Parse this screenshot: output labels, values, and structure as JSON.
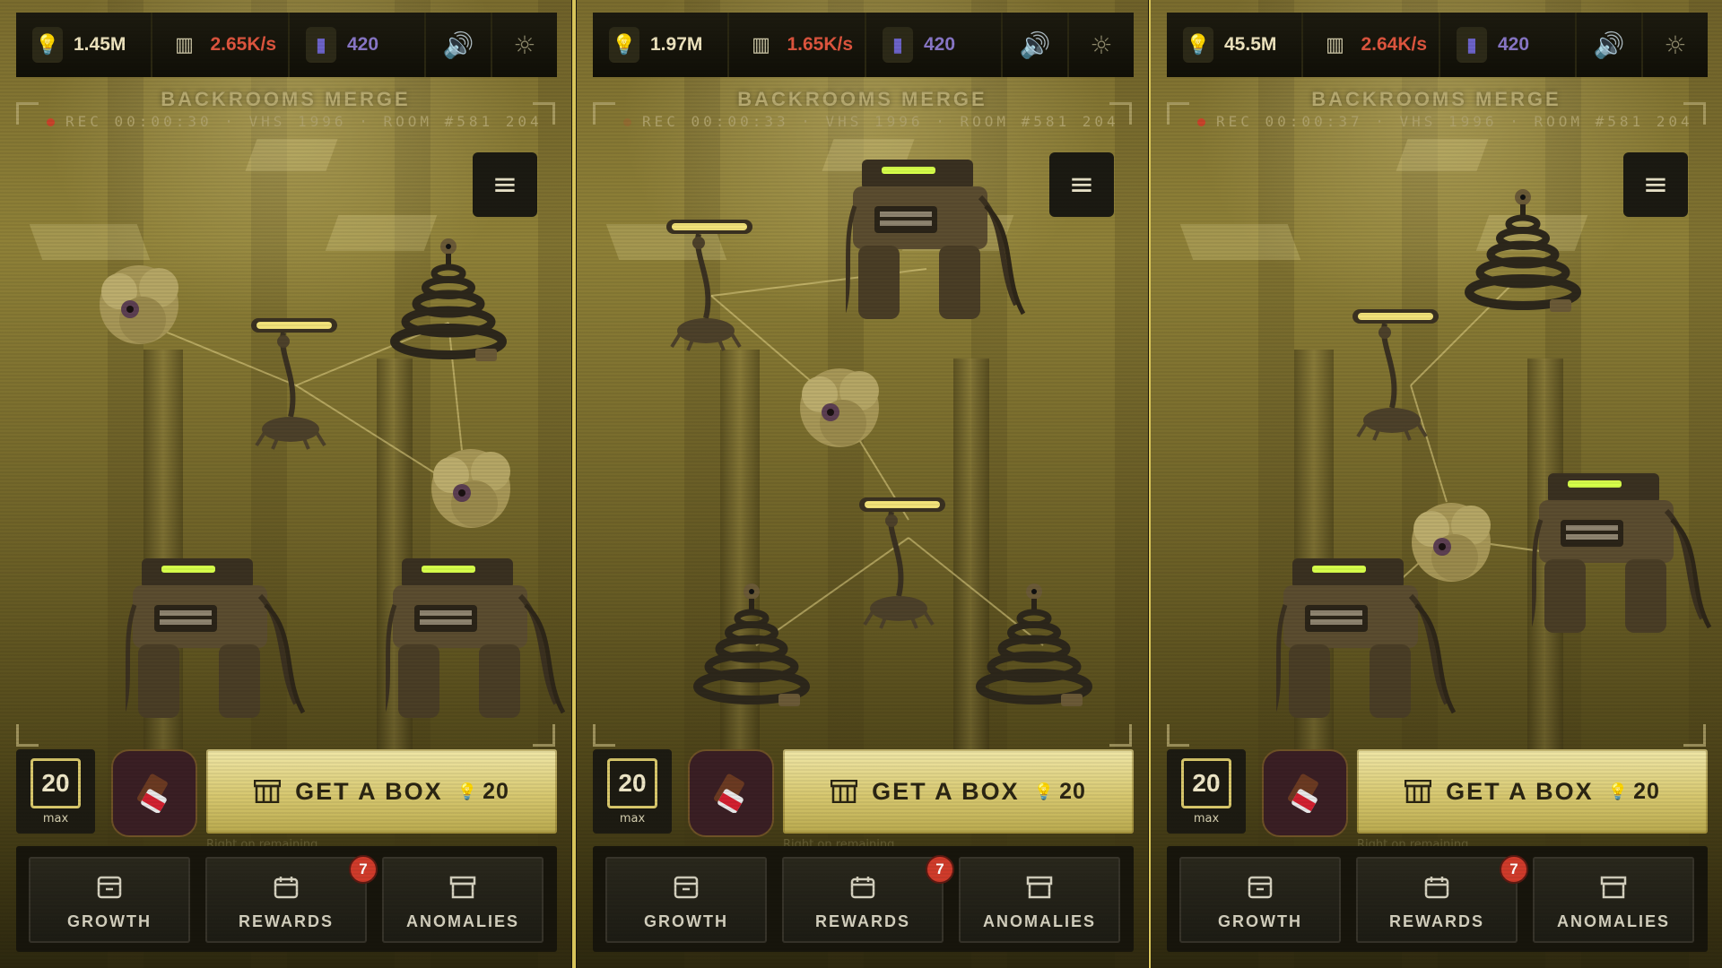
{
  "panels": [
    {
      "light": "1.45M",
      "rate": "2.65K/s",
      "gems": "420",
      "title": "BACKROOMS MERGE",
      "rec": "REC 00:00:30 · VHS 1996 · ROOM #581 204",
      "level": "20",
      "level_sub": "max",
      "get_box": "GET A BOX",
      "box_cost": "20",
      "hint": "Right on remaining",
      "nav": {
        "growth": "GROWTH",
        "rewards": "REWARDS",
        "anomalies": "ANOMALIES",
        "badge": "7"
      }
    },
    {
      "light": "1.97M",
      "rate": "1.65K/s",
      "gems": "420",
      "title": "BACKROOMS MERGE",
      "rec": "REC 00:00:33 · VHS 1996 · ROOM #581 204",
      "level": "20",
      "level_sub": "max",
      "get_box": "GET A BOX",
      "box_cost": "20",
      "hint": "Right on remaining",
      "nav": {
        "growth": "GROWTH",
        "rewards": "REWARDS",
        "anomalies": "ANOMALIES",
        "badge": "7"
      }
    },
    {
      "light": "45.5M",
      "rate": "2.64K/s",
      "gems": "420",
      "title": "BACKROOMS MERGE",
      "rec": "REC 00:00:37 · VHS 1996 · ROOM #581 204",
      "level": "20",
      "level_sub": "max",
      "get_box": "GET A BOX",
      "box_cost": "20",
      "hint": "Right on remaining",
      "nav": {
        "growth": "GROWTH",
        "rewards": "REWARDS",
        "anomalies": "ANOMALIES",
        "badge": "7"
      }
    }
  ],
  "icons": {
    "light": "lightbulb-icon",
    "rate": "bar-chart-icon",
    "gems": "gem-icon",
    "sound": "speaker-icon",
    "settings": "gear-icon",
    "menu": "hamburger-icon",
    "chocolate": "chocolate-bar-icon",
    "box": "box-icon",
    "growth": "archive-icon",
    "rewards": "calendar-icon",
    "anomalies": "archive-box-icon"
  },
  "colors": {
    "light": "#f0e6c0",
    "rate": "#e0563f",
    "gems": "#8a78c9",
    "accent": "#d8c45a",
    "badge": "#d03b2b"
  }
}
